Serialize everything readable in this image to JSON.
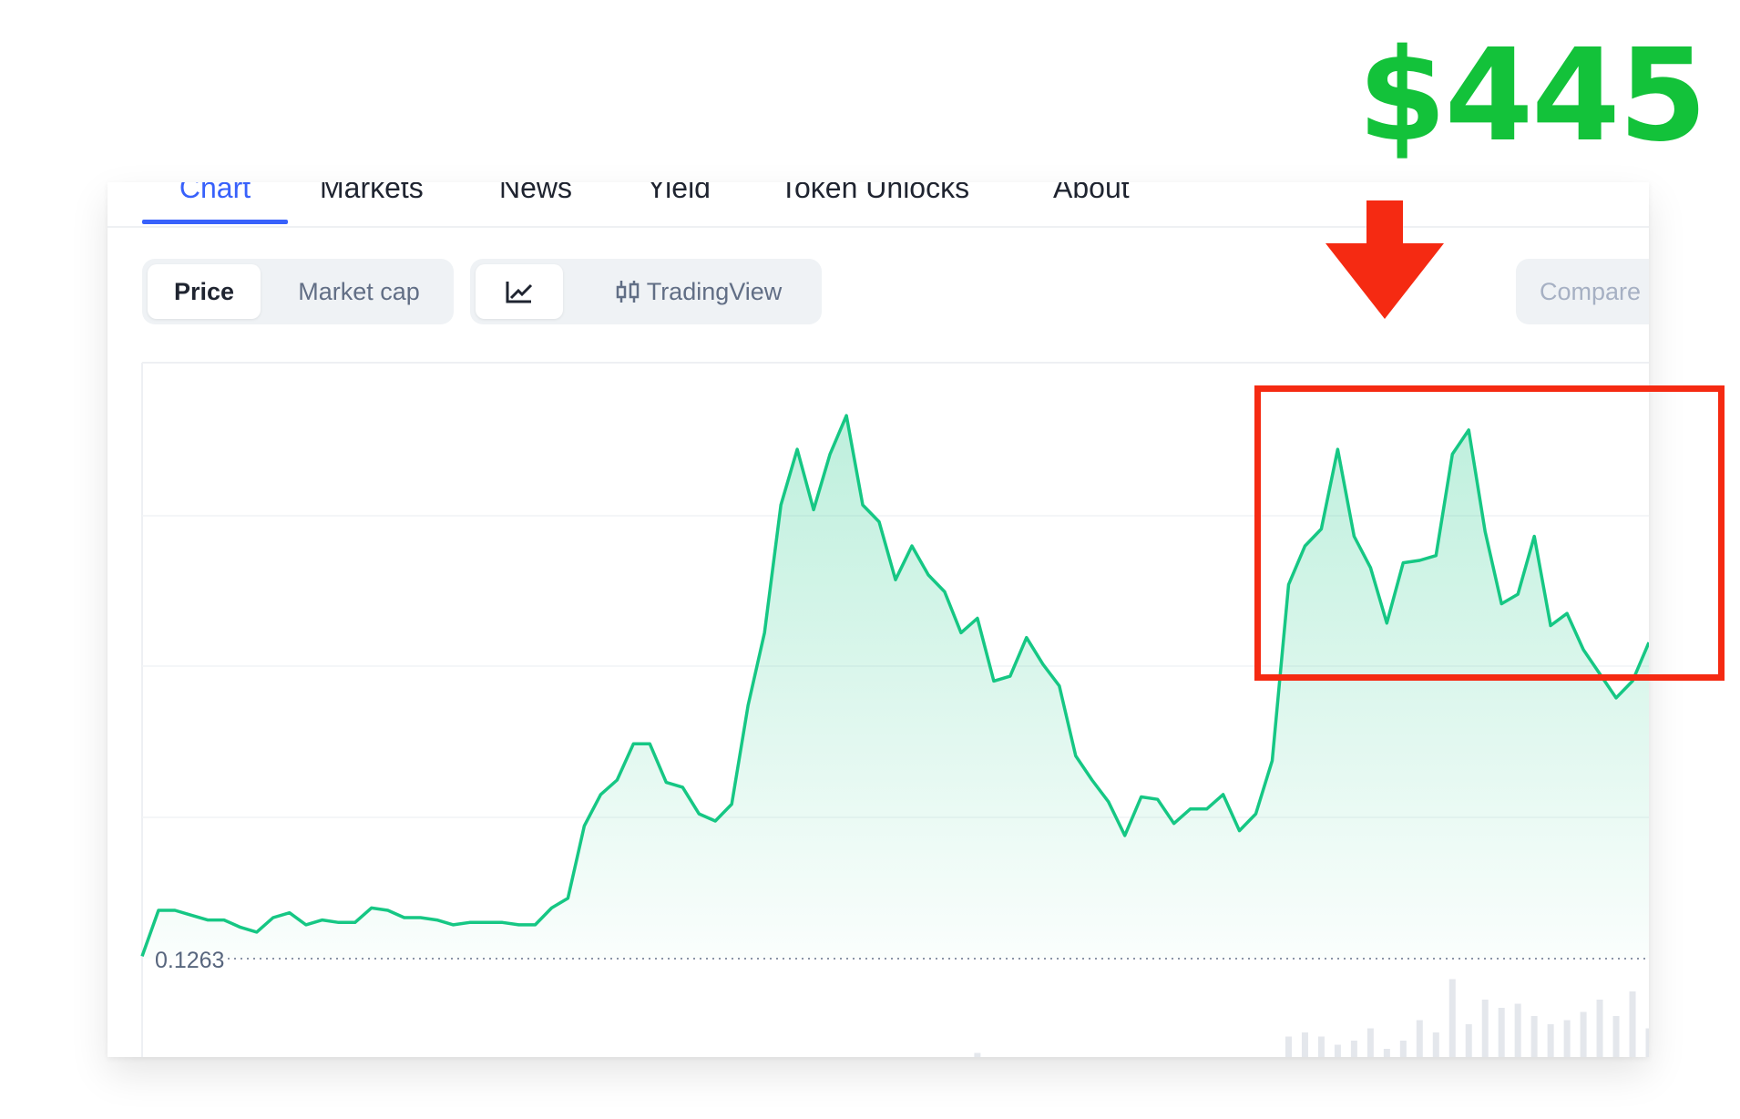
{
  "headline": {
    "price": "$445",
    "color": "#13c23a"
  },
  "tabs": [
    {
      "label": "Chart",
      "active": true
    },
    {
      "label": "Markets"
    },
    {
      "label": "News"
    },
    {
      "label": "Yield"
    },
    {
      "label": "Token Unlocks"
    },
    {
      "label": "About"
    }
  ],
  "toggles": {
    "metric": [
      {
        "label": "Price",
        "selected": true
      },
      {
        "label": "Market cap"
      }
    ],
    "view": [
      {
        "icon": "line-chart-icon",
        "selected": true
      },
      {
        "icon": "candlestick-icon",
        "label": "TradingView"
      }
    ],
    "compare_label": "Compare"
  },
  "annotations": {
    "arrow_color": "#f52a12",
    "highlight_color": "#f52a12"
  },
  "chart_data": {
    "type": "area",
    "line_color": "#16c784",
    "baseline_label": "0.1263",
    "baseline_value": 0.1263,
    "y_domain": [
      0.1263,
      0.1485
    ],
    "grid": true,
    "y": [
      0.1264,
      0.1283,
      0.1283,
      0.1281,
      0.1279,
      0.1279,
      0.1276,
      0.1274,
      0.128,
      0.1282,
      0.1277,
      0.1279,
      0.1278,
      0.1278,
      0.1284,
      0.1283,
      0.128,
      0.128,
      0.1279,
      0.1277,
      0.1278,
      0.1278,
      0.1278,
      0.1277,
      0.1277,
      0.1284,
      0.1288,
      0.1318,
      0.1331,
      0.1337,
      0.1352,
      0.1352,
      0.1336,
      0.1334,
      0.1323,
      0.132,
      0.1327,
      0.1368,
      0.1398,
      0.1451,
      0.1474,
      0.1449,
      0.1472,
      0.1488,
      0.1451,
      0.1444,
      0.142,
      0.1434,
      0.1422,
      0.1415,
      0.1398,
      0.1404,
      0.1378,
      0.138,
      0.1396,
      0.1385,
      0.1376,
      0.1347,
      0.1337,
      0.1328,
      0.1314,
      0.133,
      0.1329,
      0.1319,
      0.1325,
      0.1325,
      0.1331,
      0.1316,
      0.1323,
      0.1345,
      0.1418,
      0.1434,
      0.1441,
      0.1474,
      0.1438,
      0.1425,
      0.1402,
      0.1427,
      0.1428,
      0.143,
      0.1472,
      0.1482,
      0.144,
      0.141,
      0.1414,
      0.1438,
      0.1401,
      0.1406,
      0.1391,
      0.1381,
      0.1371,
      0.1378,
      0.1394
    ],
    "volume": [
      0,
      0,
      0,
      0,
      0,
      0,
      0,
      0,
      0,
      0,
      0,
      0,
      0,
      0,
      0,
      0,
      0,
      0,
      0,
      0,
      0,
      0,
      0,
      0,
      0,
      0,
      0,
      0,
      0,
      0,
      0,
      0,
      0,
      0,
      0,
      0,
      0,
      0,
      0,
      0,
      0,
      0,
      0,
      0,
      0,
      0,
      0,
      0,
      0,
      0,
      0,
      0.05,
      0,
      0,
      0,
      0,
      0,
      0,
      0,
      0,
      0,
      0,
      0,
      0,
      0,
      0,
      0,
      0,
      0,
      0,
      0.25,
      0.3,
      0.25,
      0.15,
      0.2,
      0.35,
      0.1,
      0.2,
      0.45,
      0.3,
      0.95,
      0.4,
      0.7,
      0.6,
      0.65,
      0.5,
      0.4,
      0.45,
      0.55,
      0.7,
      0.5,
      0.8,
      0.35
    ]
  }
}
